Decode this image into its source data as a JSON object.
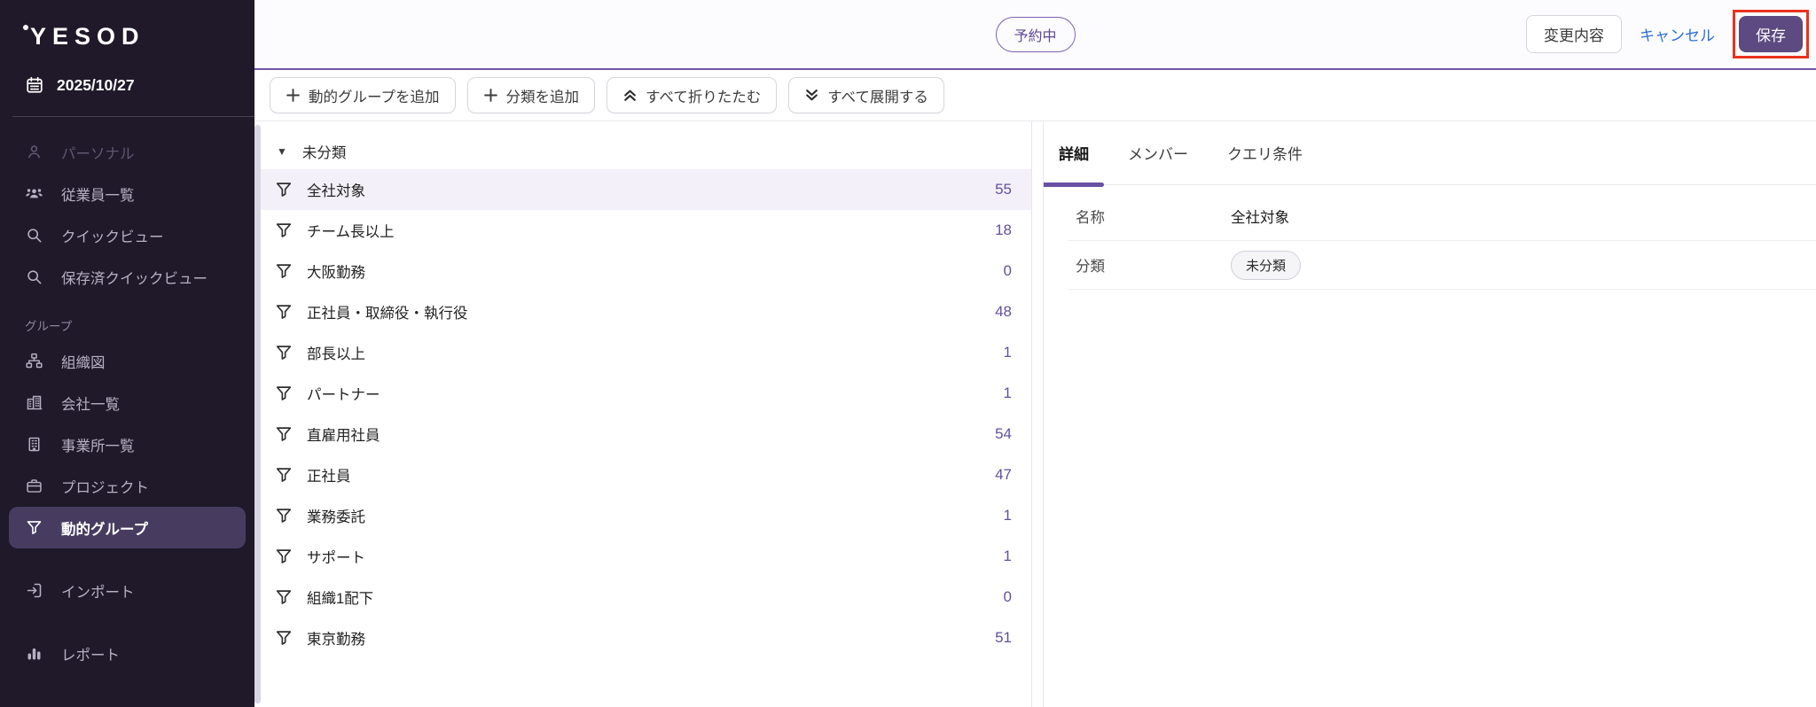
{
  "brand": {
    "logo": "YESOD"
  },
  "sidebar": {
    "date": "2025/10/27",
    "section_label": "グループ",
    "items": [
      {
        "label": "パーソナル"
      },
      {
        "label": "従業員一覧"
      },
      {
        "label": "クイックビュー"
      },
      {
        "label": "保存済クイックビュー"
      },
      {
        "label": "組織図"
      },
      {
        "label": "会社一覧"
      },
      {
        "label": "事業所一覧"
      },
      {
        "label": "プロジェクト"
      },
      {
        "label": "動的グループ"
      },
      {
        "label": "インポート"
      },
      {
        "label": "レポート"
      }
    ]
  },
  "topbar": {
    "status_badge": "予約中",
    "changes_button": "変更内容",
    "cancel_link": "キャンセル",
    "save_button": "保存"
  },
  "toolbar": {
    "add_dynamic_group": "動的グループを追加",
    "add_category": "分類を追加",
    "collapse_all": "すべて折りたたむ",
    "expand_all": "すべて展開する"
  },
  "groups": {
    "category_label": "未分類",
    "items": [
      {
        "name": "全社対象",
        "count": 55
      },
      {
        "name": "チーム長以上",
        "count": 18
      },
      {
        "name": "大阪勤務",
        "count": 0
      },
      {
        "name": "正社員・取締役・執行役",
        "count": 48
      },
      {
        "name": "部長以上",
        "count": 1
      },
      {
        "name": "パートナー",
        "count": 1
      },
      {
        "name": "直雇用社員",
        "count": 54
      },
      {
        "name": "正社員",
        "count": 47
      },
      {
        "name": "業務委託",
        "count": 1
      },
      {
        "name": "サポート",
        "count": 1
      },
      {
        "name": "組織1配下",
        "count": 0
      },
      {
        "name": "東京勤務",
        "count": 51
      }
    ]
  },
  "detail": {
    "tabs": [
      {
        "label": "詳細"
      },
      {
        "label": "メンバー"
      },
      {
        "label": "クエリ条件"
      }
    ],
    "fields": {
      "name_label": "名称",
      "name_value": "全社対象",
      "category_label": "分類",
      "category_value": "未分類"
    }
  },
  "colors": {
    "accent_purple": "#6750a4",
    "topbar_border_purple": "#6e56a8",
    "save_button_bg": "#5c4a80",
    "annotation_red": "#e8321f",
    "cancel_link_blue": "#2e6fd8",
    "count_purple": "#64509d",
    "sidebar_bg": "#1f1929",
    "sidebar_selected_bg": "#473c60",
    "selected_row_bg": "#f3f0f9"
  }
}
